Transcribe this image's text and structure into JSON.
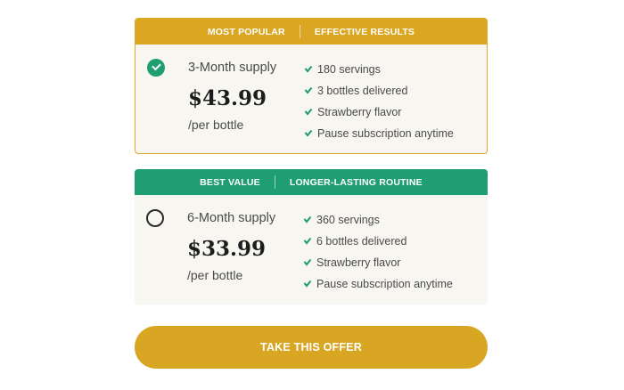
{
  "plans": [
    {
      "tags": [
        "MOST POPULAR",
        "EFFECTIVE RESULTS"
      ],
      "supply": "3-Month supply",
      "price": "$43.99",
      "unit": "/per bottle",
      "selected": true,
      "header_color": "#dba622",
      "features": [
        "180 servings",
        "3 bottles delivered",
        "Strawberry flavor",
        "Pause subscription anytime"
      ]
    },
    {
      "tags": [
        "BEST VALUE",
        "LONGER-LASTING ROUTINE"
      ],
      "supply": "6-Month supply",
      "price": "$33.99",
      "unit": "/per bottle",
      "selected": false,
      "header_color": "#1f9e73",
      "features": [
        "360 servings",
        "6 bottles delivered",
        "Strawberry flavor",
        "Pause subscription anytime"
      ]
    }
  ],
  "cta": {
    "label": "TAKE THIS OFFER",
    "color": "#d9a624"
  },
  "colors": {
    "accent_green": "#1f9e73",
    "accent_gold": "#dba622",
    "card_bg": "#f8f6f0"
  },
  "icons": {
    "selected": "check-circle-icon",
    "unselected": "radio-empty-icon",
    "feature": "checkmark-icon"
  }
}
